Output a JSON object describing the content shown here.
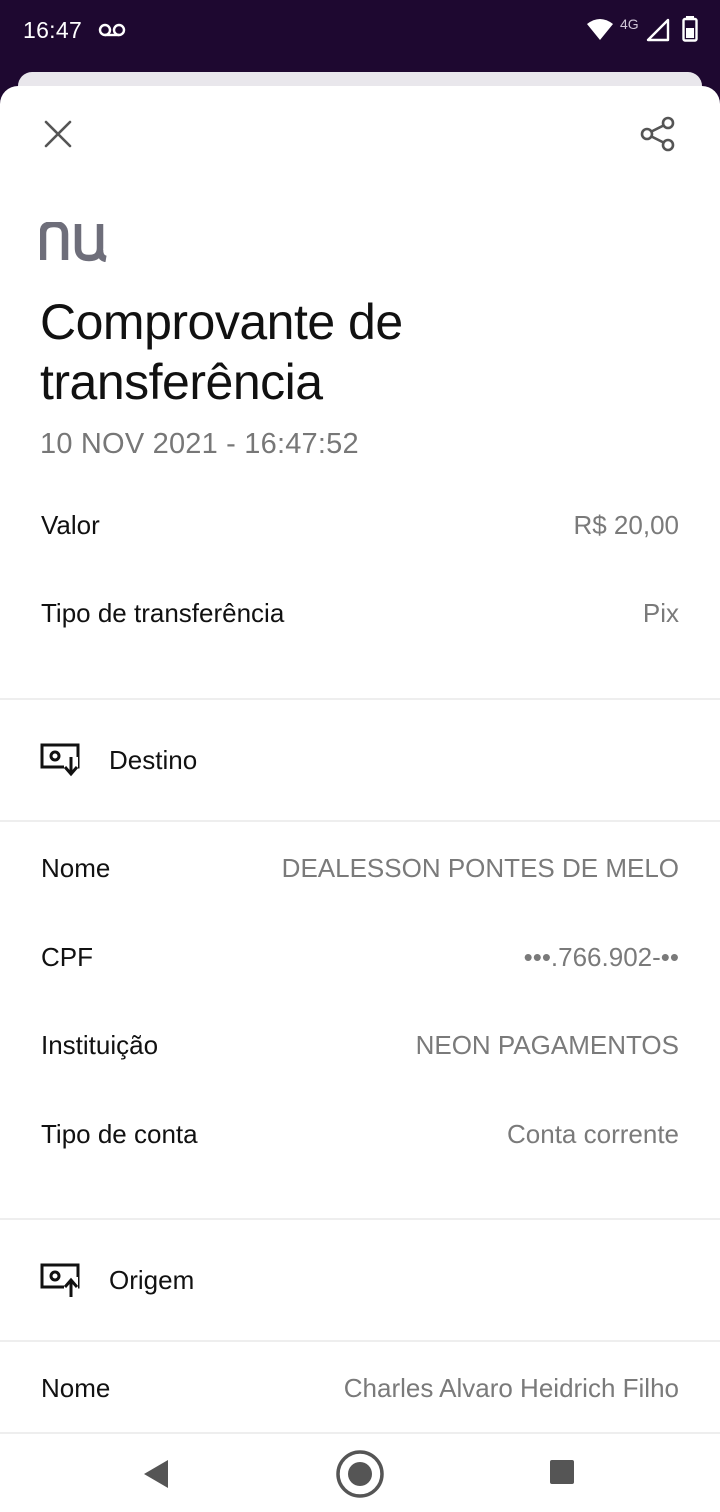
{
  "status_bar": {
    "time": "16:47",
    "network": "4G",
    "icons": [
      "voicemail-icon",
      "wifi-icon",
      "cell-signal-icon",
      "battery-icon"
    ]
  },
  "header": {
    "close_icon": "close-icon",
    "share_icon": "share-icon",
    "logo_text": "nu"
  },
  "receipt": {
    "title": "Comprovante de transferência",
    "datetime": "10 NOV 2021 - 16:47:52"
  },
  "summary": [
    {
      "label": "Valor",
      "value": "R$ 20,00"
    },
    {
      "label": "Tipo de transferência",
      "value": "Pix"
    }
  ],
  "destino": {
    "title": "Destino",
    "icon": "money-in-icon",
    "rows": [
      {
        "label": "Nome",
        "value": "DEALESSON PONTES DE MELO"
      },
      {
        "label": "CPF",
        "value": "•••.766.902-••"
      },
      {
        "label": "Instituição",
        "value": "NEON PAGAMENTOS"
      },
      {
        "label": "Tipo de conta",
        "value": "Conta corrente"
      }
    ]
  },
  "origem": {
    "title": "Origem",
    "icon": "money-out-icon",
    "rows": [
      {
        "label": "Nome",
        "value": "Charles Alvaro Heidrich Filho"
      }
    ]
  },
  "nav_bar": {
    "icons": [
      "back-icon",
      "home-icon",
      "recents-icon"
    ]
  },
  "colors": {
    "status_bar_bg": "#1e0830",
    "text_primary": "#111111",
    "text_secondary": "#7a7a7a",
    "logo": "#6e6e7a"
  }
}
